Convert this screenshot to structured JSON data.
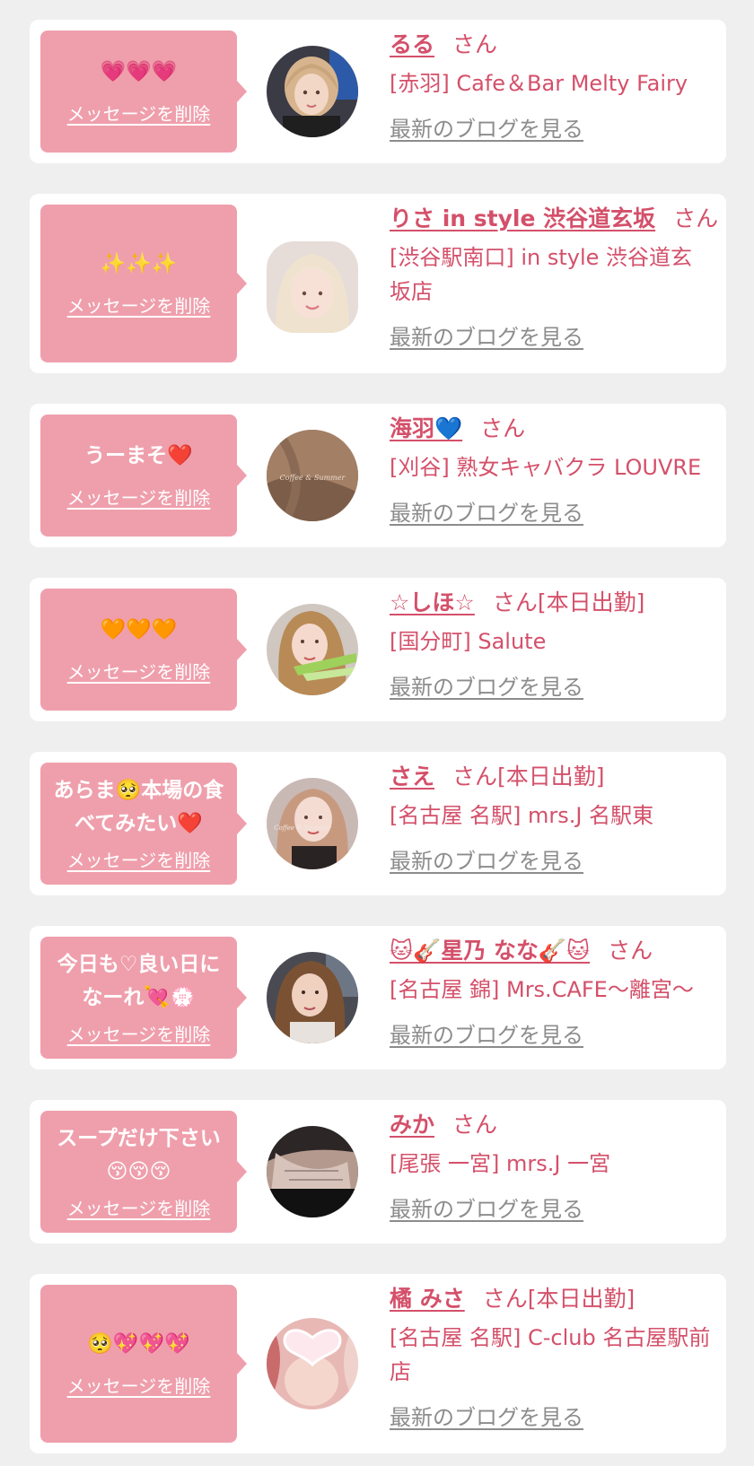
{
  "colors": {
    "background": "#efefef",
    "card": "#ffffff",
    "bubble": "#ef9fac",
    "accent_text": "#d4506a",
    "link_gray": "#8c8c8c"
  },
  "delete_label": "メッセージを削除",
  "blog_label": "最新のブログを見る",
  "san_label": "さん",
  "messages": [
    {
      "message": "💗💗💗",
      "name": "るる",
      "status": "",
      "shop": "[赤羽] Cafe＆Bar Melty Fairy",
      "avatar_icon": "girl-photo-avatar"
    },
    {
      "message": "✨✨✨",
      "name": "りさ in style 渋谷道玄坂",
      "status": "",
      "shop": "[渋谷駅南口] in style 渋谷道玄坂店",
      "avatar_icon": "girl-photo-avatar"
    },
    {
      "message": "うーまそ❤️",
      "name": "海羽💙",
      "status": "",
      "shop": "[刈谷] 熟女キャバクラ LOUVRE",
      "avatar_icon": "girl-photo-avatar"
    },
    {
      "message": "🧡🧡🧡",
      "name": "☆しほ☆",
      "status": "[本日出勤]",
      "shop": "[国分町] Salute",
      "avatar_icon": "girl-photo-avatar"
    },
    {
      "message": "あらま🥺本場の食べてみたい❤️",
      "name": "さえ",
      "status": "[本日出勤]",
      "shop": "[名古屋 名駅] mrs.J 名駅東",
      "avatar_icon": "girl-photo-avatar"
    },
    {
      "message": "今日も♡良い日になーれ💘💮",
      "name": "🐱🎸星乃 なな🎸🐱",
      "status": "",
      "shop": "[名古屋 錦] Mrs.CAFE〜離宮〜",
      "avatar_icon": "girl-photo-avatar"
    },
    {
      "message": "スープだけ下さい😚😚😚",
      "name": "みか",
      "status": "",
      "shop": "[尾張 一宮] mrs.J 一宮",
      "avatar_icon": "girl-photo-avatar"
    },
    {
      "message": "🥺💖💖💖",
      "name": "橘 みさ",
      "status": "[本日出勤]",
      "shop": "[名古屋 名駅] C-club 名古屋駅前店",
      "avatar_icon": "heart-sticker-avatar"
    }
  ]
}
